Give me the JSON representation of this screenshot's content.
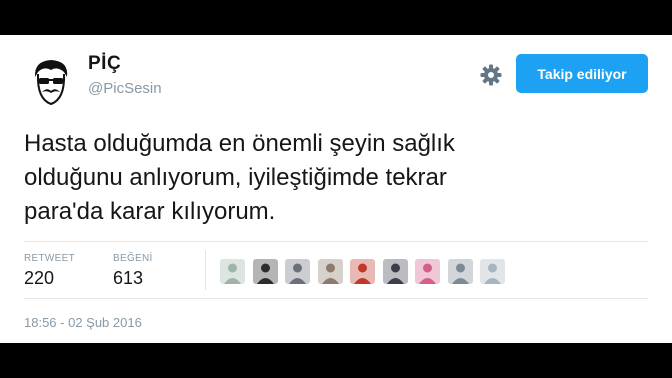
{
  "user": {
    "name": "PİÇ",
    "handle": "@PicSesin"
  },
  "follow_button": {
    "label": "Takip ediliyor"
  },
  "tweet": {
    "lines": [
      "Hasta olduğumda en önemli şeyin sağlık",
      "olduğunu anlıyorum, iyileştiğimde tekrar",
      "para'da karar kılıyorum."
    ]
  },
  "stats": {
    "retweets": {
      "label": "RETWEET",
      "value": "220"
    },
    "likes": {
      "label": "BEĞENİ",
      "value": "613"
    }
  },
  "likers": [
    {
      "icon": "liker-avatar",
      "color": "#9fb4a8"
    },
    {
      "icon": "liker-avatar",
      "color": "#2c2c2c"
    },
    {
      "icon": "liker-avatar",
      "color": "#6b6f78"
    },
    {
      "icon": "liker-avatar",
      "color": "#8c7a6a"
    },
    {
      "icon": "liker-avatar",
      "color": "#c0392b"
    },
    {
      "icon": "liker-avatar",
      "color": "#3c3f4a"
    },
    {
      "icon": "liker-avatar",
      "color": "#d35f8a"
    },
    {
      "icon": "liker-avatar",
      "color": "#7d8a96"
    },
    {
      "icon": "liker-avatar",
      "color": "#a8b4be"
    }
  ],
  "timestamp": "18:56 - 02 Şub 2016",
  "colors": {
    "accent": "#1da1f2",
    "secondary_text": "#8899a6",
    "divider": "#e1e8ed"
  }
}
